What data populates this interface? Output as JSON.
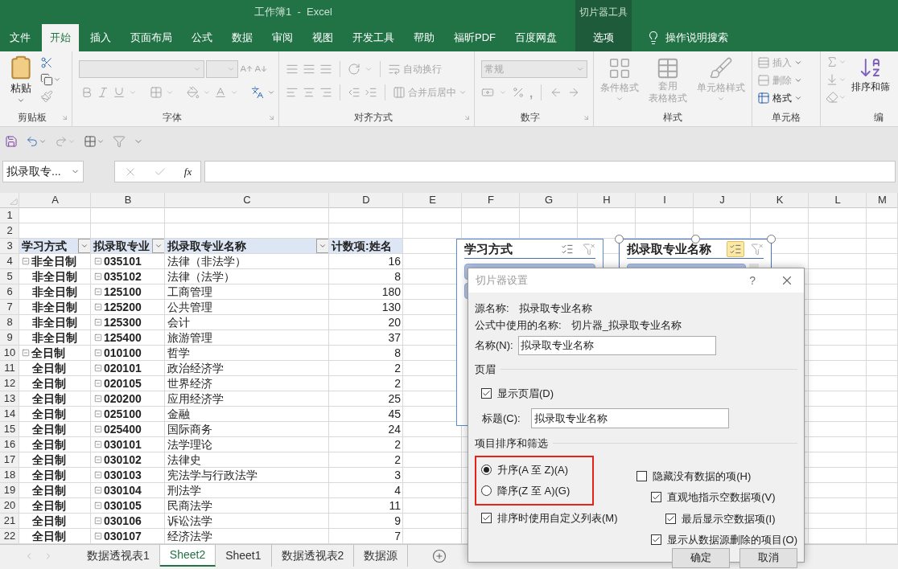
{
  "window": {
    "title": "工作簿1  -  Excel",
    "context_group": "切片器工具"
  },
  "ribbon_tabs": [
    {
      "label": "文件",
      "selected": false,
      "kind": "normal"
    },
    {
      "label": "开始",
      "selected": true,
      "kind": "normal"
    },
    {
      "label": "插入",
      "selected": false,
      "kind": "normal"
    },
    {
      "label": "页面布局",
      "selected": false,
      "kind": "normal"
    },
    {
      "label": "公式",
      "selected": false,
      "kind": "normal"
    },
    {
      "label": "数据",
      "selected": false,
      "kind": "normal"
    },
    {
      "label": "审阅",
      "selected": false,
      "kind": "normal"
    },
    {
      "label": "视图",
      "selected": false,
      "kind": "normal"
    },
    {
      "label": "开发工具",
      "selected": false,
      "kind": "normal"
    },
    {
      "label": "帮助",
      "selected": false,
      "kind": "normal"
    },
    {
      "label": "福昕PDF",
      "selected": false,
      "kind": "normal"
    },
    {
      "label": "百度网盘",
      "selected": false,
      "kind": "normal"
    },
    {
      "label": "选项",
      "selected": false,
      "kind": "context"
    }
  ],
  "tell_me": "操作说明搜索",
  "ribbon": {
    "clipboard": {
      "title": "剪贴板",
      "paste": "粘贴"
    },
    "font": {
      "title": "字体"
    },
    "alignment": {
      "title": "对齐方式",
      "wrap": "自动换行",
      "merge": "合并后居中"
    },
    "number": {
      "title": "数字",
      "format": "常规",
      "comma": ","
    },
    "styles": {
      "title": "样式",
      "conditional": "条件格式",
      "table_format": [
        "套用",
        "表格格式"
      ],
      "cell_styles": "单元格样式"
    },
    "cells": {
      "title": "单元格",
      "insert": "插入",
      "delete": "删除",
      "format": "格式"
    },
    "editing": {
      "title": "编",
      "sort": "排序和筛"
    }
  },
  "formula_bar": {
    "name_box": "拟录取专...",
    "function_label": "fx"
  },
  "sheet": {
    "columns": [
      "A",
      "B",
      "C",
      "D",
      "E",
      "F",
      "G",
      "H",
      "I",
      "J",
      "K",
      "L",
      "M"
    ],
    "row_numbers": [
      "1",
      "2",
      "3",
      "4",
      "5",
      "6",
      "7",
      "8",
      "9",
      "10",
      "11",
      "12",
      "13",
      "14",
      "15",
      "16",
      "17",
      "18",
      "19",
      "20",
      "21",
      "22"
    ]
  },
  "pivot": {
    "headers": [
      {
        "label": "学习方式",
        "filter_button": true
      },
      {
        "label": "拟录取专业",
        "filter_button": true
      },
      {
        "label": "拟录取专业名称",
        "filter_button": true
      },
      {
        "label": "计数项:姓名",
        "filter_button": false
      }
    ],
    "rows": [
      {
        "mode": "非全日制",
        "group_header": true,
        "code": "035101",
        "name": "法律（非法学）",
        "count": "16"
      },
      {
        "mode": "非全日制",
        "group_header": false,
        "code": "035102",
        "name": "法律（法学）",
        "count": "8"
      },
      {
        "mode": "非全日制",
        "group_header": false,
        "code": "125100",
        "name": "工商管理",
        "count": "180"
      },
      {
        "mode": "非全日制",
        "group_header": false,
        "code": "125200",
        "name": "公共管理",
        "count": "130"
      },
      {
        "mode": "非全日制",
        "group_header": false,
        "code": "125300",
        "name": "会计",
        "count": "20"
      },
      {
        "mode": "非全日制",
        "group_header": false,
        "code": "125400",
        "name": "旅游管理",
        "count": "37"
      },
      {
        "mode": "全日制",
        "group_header": true,
        "code": "010100",
        "name": "哲学",
        "count": "8"
      },
      {
        "mode": "全日制",
        "group_header": false,
        "code": "020101",
        "name": "政治经济学",
        "count": "2"
      },
      {
        "mode": "全日制",
        "group_header": false,
        "code": "020105",
        "name": "世界经济",
        "count": "2"
      },
      {
        "mode": "全日制",
        "group_header": false,
        "code": "020200",
        "name": "应用经济学",
        "count": "25"
      },
      {
        "mode": "全日制",
        "group_header": false,
        "code": "025100",
        "name": "金融",
        "count": "45"
      },
      {
        "mode": "全日制",
        "group_header": false,
        "code": "025400",
        "name": "国际商务",
        "count": "24"
      },
      {
        "mode": "全日制",
        "group_header": false,
        "code": "030101",
        "name": "法学理论",
        "count": "2"
      },
      {
        "mode": "全日制",
        "group_header": false,
        "code": "030102",
        "name": "法律史",
        "count": "2"
      },
      {
        "mode": "全日制",
        "group_header": false,
        "code": "030103",
        "name": "宪法学与行政法学",
        "count": "3"
      },
      {
        "mode": "全日制",
        "group_header": false,
        "code": "030104",
        "name": "刑法学",
        "count": "4"
      },
      {
        "mode": "全日制",
        "group_header": false,
        "code": "030105",
        "name": "民商法学",
        "count": "11"
      },
      {
        "mode": "全日制",
        "group_header": false,
        "code": "030106",
        "name": "诉讼法学",
        "count": "9"
      },
      {
        "mode": "全日制",
        "group_header": false,
        "code": "030107",
        "name": "经济法学",
        "count": "7"
      }
    ]
  },
  "slicers": [
    {
      "title": "学习方式",
      "selected": false,
      "multi_select": false
    },
    {
      "title": "拟录取专业名称",
      "selected": true,
      "multi_select": true
    }
  ],
  "dialog": {
    "title": "切片器设置",
    "help": "?",
    "source_label": "源名称:",
    "source_value": "拟录取专业名称",
    "formula_label": "公式中使用的名称:",
    "formula_value": "切片器_拟录取专业名称",
    "name_label": "名称(N):",
    "name_value": "拟录取专业名称",
    "header_section": "页眉",
    "show_header": {
      "label": "显示页眉(D)",
      "checked": true
    },
    "caption_label": "标题(C):",
    "caption_value": "拟录取专业名称",
    "sort_section": "项目排序和筛选",
    "highlight_sort_options": true,
    "sort_options": [
      {
        "label": "升序(A 至 Z)(A)",
        "selected": true
      },
      {
        "label": "降序(Z 至 A)(G)",
        "selected": false
      }
    ],
    "custom_list": {
      "label": "排序时使用自定义列表(M)",
      "checked": true
    },
    "filter_options": [
      {
        "label": "隐藏没有数据的项(H)",
        "checked": false,
        "children": [
          {
            "label": "直观地指示空数据项(V)",
            "checked": true,
            "children": [
              {
                "label": "最后显示空数据项(I)",
                "checked": true
              }
            ]
          },
          {
            "label": "显示从数据源删除的项目(O)",
            "checked": true
          }
        ]
      }
    ],
    "buttons": [
      "确定",
      "取消"
    ]
  },
  "sheet_tabs": [
    {
      "label": "数据透视表1",
      "selected": false
    },
    {
      "label": "Sheet2",
      "selected": true
    },
    {
      "label": "Sheet1",
      "selected": false
    },
    {
      "label": "数据透视表2",
      "selected": false
    },
    {
      "label": "数据源",
      "selected": false
    }
  ]
}
